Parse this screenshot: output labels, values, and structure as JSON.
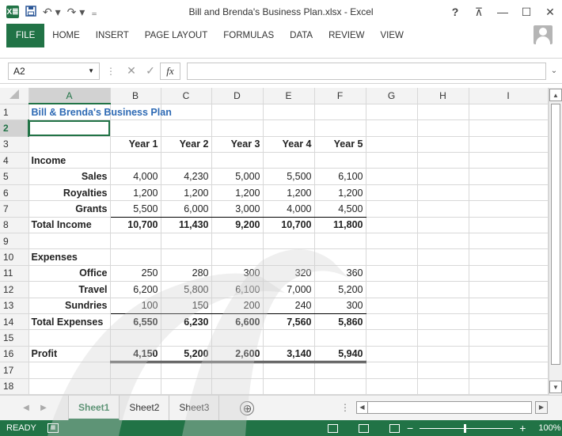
{
  "window": {
    "title": "Bill and Brenda's Business Plan.xlsx - Excel",
    "help": "?",
    "ribbon_toggle": "⊼",
    "minimize": "—",
    "maximize": "☐",
    "close": "✕"
  },
  "qat": {
    "logo": "X≣",
    "save_icon": "save-icon",
    "undo": "↶ ▾",
    "redo": "↷ ▾",
    "customize": "₌"
  },
  "ribbon": {
    "tabs": [
      "FILE",
      "HOME",
      "INSERT",
      "PAGE LAYOUT",
      "FORMULAS",
      "DATA",
      "REVIEW",
      "VIEW"
    ]
  },
  "formula_bar": {
    "name_box": "A2",
    "cancel": "✕",
    "enter": "✓",
    "fx": "fx",
    "value": ""
  },
  "columns": [
    "A",
    "B",
    "C",
    "D",
    "E",
    "F",
    "G",
    "H",
    "I"
  ],
  "selected": {
    "column": "A",
    "row": "2"
  },
  "rows": [
    {
      "n": "1",
      "cells": [
        "Bill & Brenda's Business Plan",
        "",
        "",
        "",
        "",
        "",
        "",
        "",
        ""
      ]
    },
    {
      "n": "2",
      "cells": [
        "",
        "",
        "",
        "",
        "",
        "",
        "",
        "",
        ""
      ]
    },
    {
      "n": "3",
      "cells": [
        "",
        "Year 1",
        "Year 2",
        "Year 3",
        "Year 4",
        "Year 5",
        "",
        "",
        ""
      ]
    },
    {
      "n": "4",
      "cells": [
        "Income",
        "",
        "",
        "",
        "",
        "",
        "",
        "",
        ""
      ]
    },
    {
      "n": "5",
      "cells": [
        "Sales",
        "4,000",
        "4,230",
        "5,000",
        "5,500",
        "6,100",
        "",
        "",
        ""
      ]
    },
    {
      "n": "6",
      "cells": [
        "Royalties",
        "1,200",
        "1,200",
        "1,200",
        "1,200",
        "1,200",
        "",
        "",
        ""
      ]
    },
    {
      "n": "7",
      "cells": [
        "Grants",
        "5,500",
        "6,000",
        "3,000",
        "4,000",
        "4,500",
        "",
        "",
        ""
      ]
    },
    {
      "n": "8",
      "cells": [
        "Total Income",
        "10,700",
        "11,430",
        "9,200",
        "10,700",
        "11,800",
        "",
        "",
        ""
      ]
    },
    {
      "n": "9",
      "cells": [
        "",
        "",
        "",
        "",
        "",
        "",
        "",
        "",
        ""
      ]
    },
    {
      "n": "10",
      "cells": [
        "Expenses",
        "",
        "",
        "",
        "",
        "",
        "",
        "",
        ""
      ]
    },
    {
      "n": "11",
      "cells": [
        "Office",
        "250",
        "280",
        "300",
        "320",
        "360",
        "",
        "",
        ""
      ]
    },
    {
      "n": "12",
      "cells": [
        "Travel",
        "6,200",
        "5,800",
        "6,100",
        "7,000",
        "5,200",
        "",
        "",
        ""
      ]
    },
    {
      "n": "13",
      "cells": [
        "Sundries",
        "100",
        "150",
        "200",
        "240",
        "300",
        "",
        "",
        ""
      ]
    },
    {
      "n": "14",
      "cells": [
        "Total Expenses",
        "6,550",
        "6,230",
        "6,600",
        "7,560",
        "5,860",
        "",
        "",
        ""
      ]
    },
    {
      "n": "15",
      "cells": [
        "",
        "",
        "",
        "",
        "",
        "",
        "",
        "",
        ""
      ]
    },
    {
      "n": "16",
      "cells": [
        "Profit",
        "4,150",
        "5,200",
        "2,600",
        "3,140",
        "5,940",
        "",
        "",
        ""
      ]
    },
    {
      "n": "17",
      "cells": [
        "",
        "",
        "",
        "",
        "",
        "",
        "",
        "",
        ""
      ]
    },
    {
      "n": "18",
      "cells": [
        "",
        "",
        "",
        "",
        "",
        "",
        "",
        "",
        ""
      ]
    }
  ],
  "sheets": {
    "tabs": [
      "Sheet1",
      "Sheet2",
      "Sheet3"
    ],
    "active": "Sheet1",
    "add": "⊕"
  },
  "status": {
    "text": "READY",
    "zoom": "100%"
  },
  "colors": {
    "accent": "#217346",
    "title": "#2e6ab4"
  }
}
